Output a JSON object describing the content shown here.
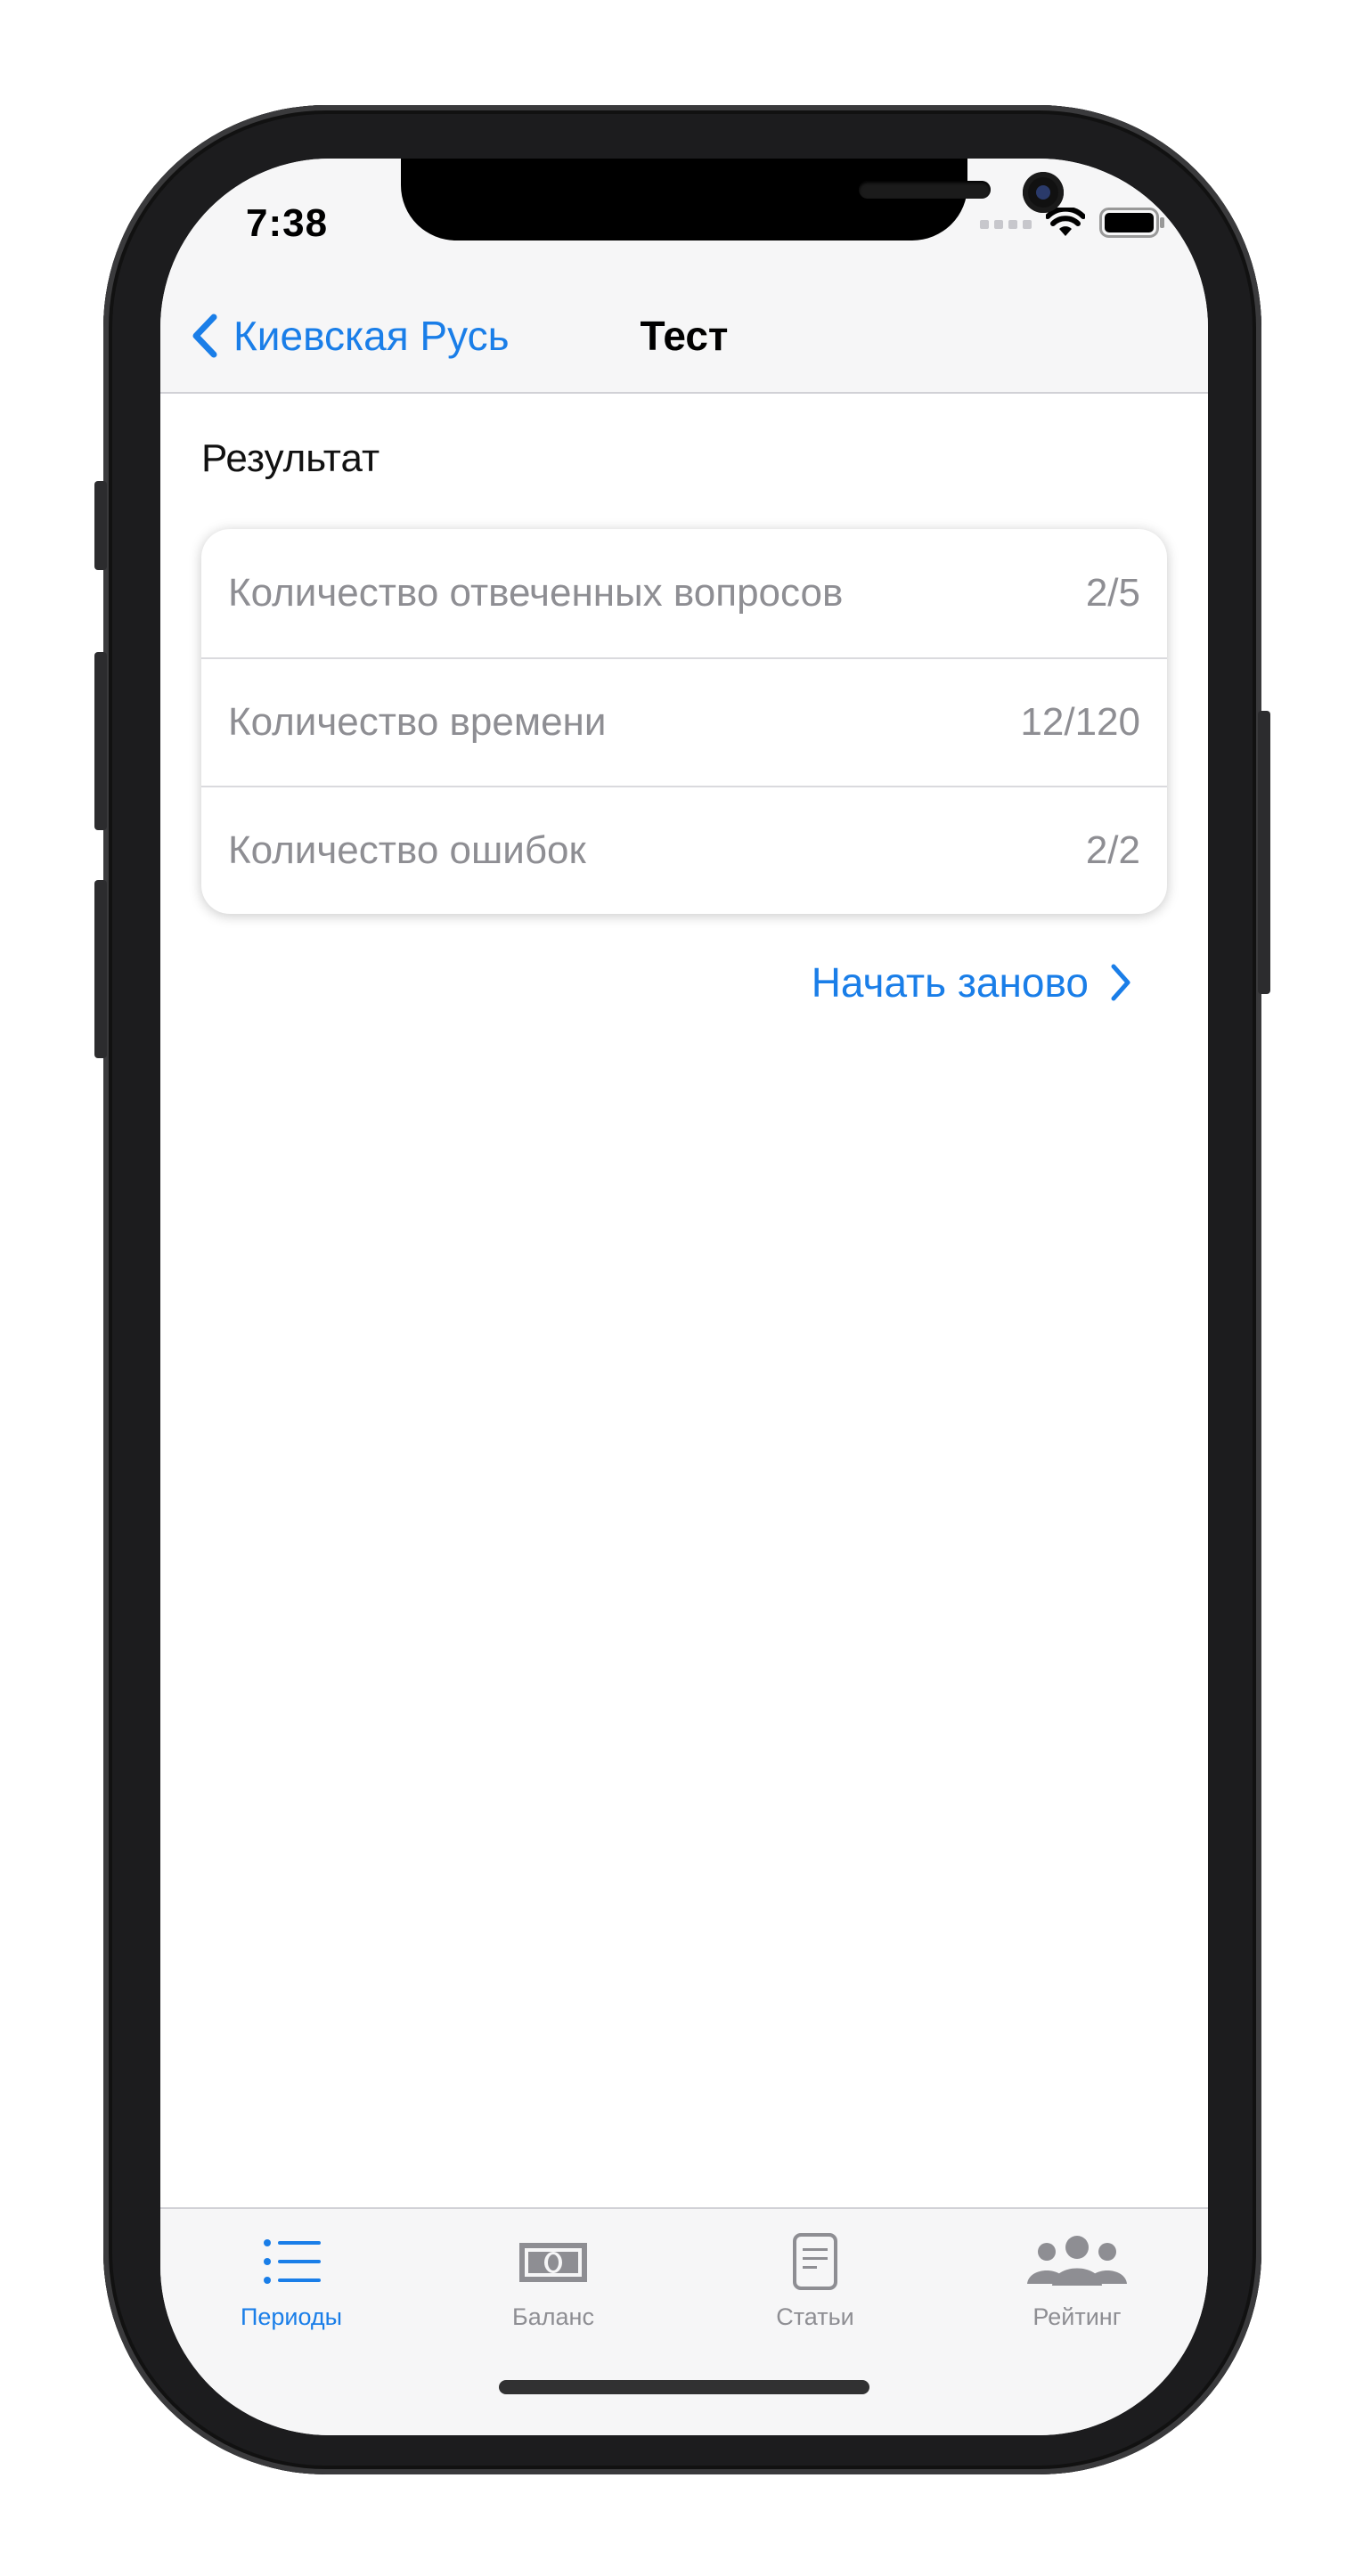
{
  "status_bar": {
    "time": "7:38"
  },
  "nav": {
    "back_label": "Киевская Русь",
    "title": "Тест"
  },
  "result": {
    "section_title": "Результат",
    "rows": [
      {
        "label": "Количество отвеченных вопросов",
        "value": "2/5"
      },
      {
        "label": "Количество времени",
        "value": "12/120"
      },
      {
        "label": "Количество ошибок",
        "value": "2/2"
      }
    ]
  },
  "restart_label": "Начать заново",
  "tab_bar": {
    "tabs": [
      {
        "label": "Периоды",
        "icon": "list-icon",
        "active": true
      },
      {
        "label": "Баланс",
        "icon": "banknote-icon",
        "active": false
      },
      {
        "label": "Статьи",
        "icon": "document-icon",
        "active": false
      },
      {
        "label": "Рейтинг",
        "icon": "people-icon",
        "active": false
      }
    ]
  },
  "colors": {
    "accent": "#1a7ee8",
    "secondary_text": "#8e8e93",
    "bar_background": "#f6f6f7"
  }
}
